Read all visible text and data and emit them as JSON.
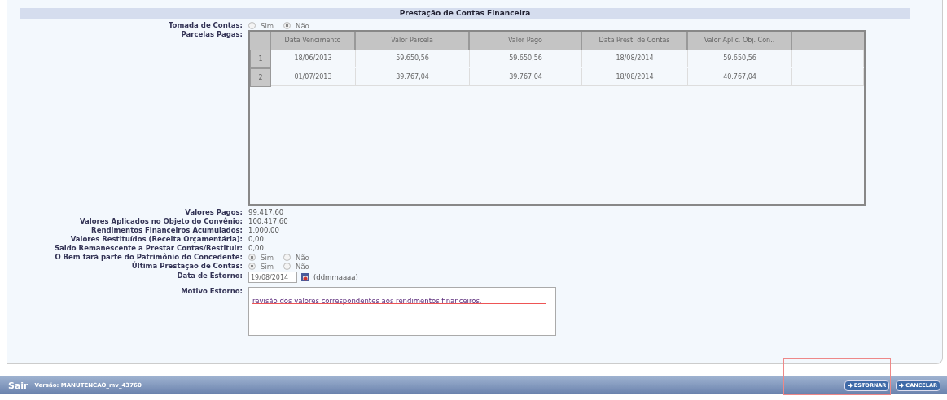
{
  "section_title": "Prestação de Contas Financeira",
  "tomada_de_contas": {
    "label": "Tomada de Contas:",
    "options": [
      {
        "label": "Sim",
        "selected": false
      },
      {
        "label": "Não",
        "selected": true
      }
    ]
  },
  "parcelas_pagas": {
    "label": "Parcelas Pagas:",
    "columns": [
      "Data Vencimento",
      "Valor Parcela",
      "Valor Pago",
      "Data Prest. de Contas",
      "Valor Aplic. Obj. Con.."
    ],
    "rows": [
      {
        "index": "1",
        "cells": [
          "18/06/2013",
          "59.650,56",
          "59.650,56",
          "18/08/2014",
          "59.650,56"
        ]
      },
      {
        "index": "2",
        "cells": [
          "01/07/2013",
          "39.767,04",
          "39.767,04",
          "18/08/2014",
          "40.767,04"
        ]
      }
    ]
  },
  "summary": [
    {
      "kind": "text",
      "label": "Valores Pagos:",
      "value": "99.417,60"
    },
    {
      "kind": "text",
      "label": "Valores Aplicados no Objeto do Convênio:",
      "value": "100.417,60"
    },
    {
      "kind": "text",
      "label": "Rendimentos Financeiros Acumulados:",
      "value": "1.000,00"
    },
    {
      "kind": "text",
      "label": "Valores Restituídos (Receita Orçamentária):",
      "value": "0,00"
    },
    {
      "kind": "text",
      "label": "Saldo Remanescente a Prestar Contas/Restituir:",
      "value": "0,00"
    },
    {
      "kind": "radio",
      "label": "O Bem fará parte do Patrimônio do Concedente:",
      "options": [
        {
          "label": "Sim",
          "selected": true
        },
        {
          "label": "Não",
          "selected": false
        }
      ]
    },
    {
      "kind": "radio",
      "label": "Última Prestação de Contas:",
      "options": [
        {
          "label": "Sim",
          "selected": true
        },
        {
          "label": "Não",
          "selected": false
        }
      ]
    }
  ],
  "data_estorno": {
    "label": "Data de Estorno:",
    "value": "19/08/2014",
    "hint": "(ddmmaaaa)"
  },
  "motivo_estorno": {
    "label": "Motivo Estorno:",
    "value": "revisão dos valores correspondentes aos rendimentos financeiros."
  },
  "footer": {
    "exit": "Sair",
    "version": "Versão: MANUTENCAO_mv_43760",
    "buttons": [
      "ESTORNAR",
      "CANCELAR"
    ]
  }
}
